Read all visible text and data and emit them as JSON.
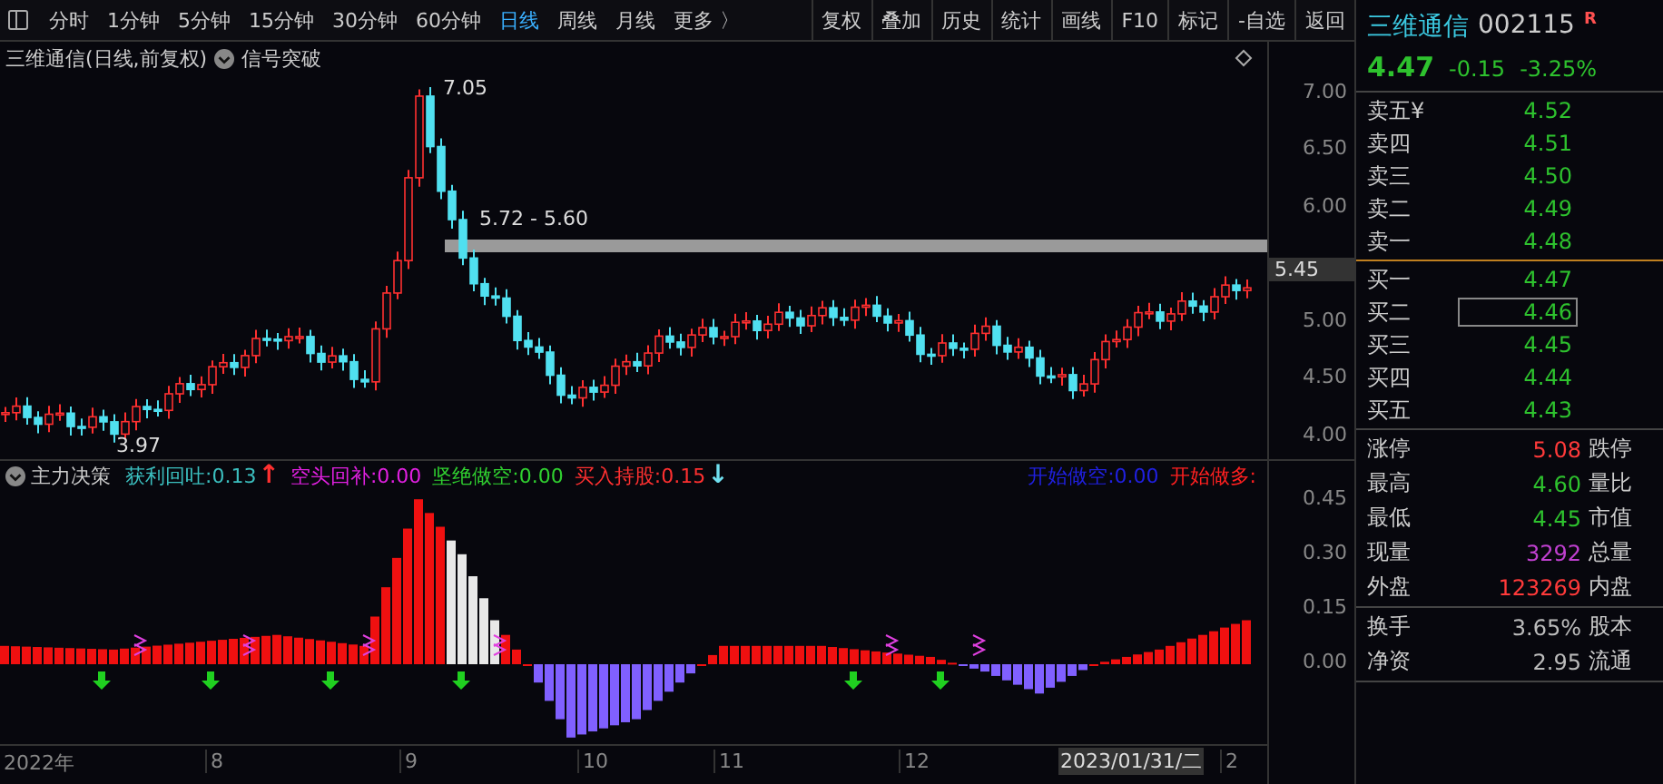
{
  "toolbar": {
    "periods": [
      {
        "label": "分时",
        "selected": false
      },
      {
        "label": "1分钟",
        "selected": false
      },
      {
        "label": "5分钟",
        "selected": false
      },
      {
        "label": "15分钟",
        "selected": false
      },
      {
        "label": "30分钟",
        "selected": false
      },
      {
        "label": "60分钟",
        "selected": false
      },
      {
        "label": "日线",
        "selected": true
      },
      {
        "label": "周线",
        "selected": false
      },
      {
        "label": "月线",
        "selected": false
      },
      {
        "label": "更多 〉",
        "selected": false
      }
    ],
    "tools": [
      "复权",
      "叠加",
      "历史",
      "统计",
      "画线",
      "F10",
      "标记",
      "-自选",
      "返回"
    ]
  },
  "chart": {
    "title": "三维通信(日线,前复权)",
    "indicator": "信号突破",
    "high_label": "7.05",
    "band_label": "5.72 - 5.60",
    "low_label": "3.97",
    "current_price": "5.45",
    "yticks": [
      "7.00",
      "6.50",
      "6.00",
      "5.00",
      "4.50",
      "4.00"
    ]
  },
  "indicator": {
    "name": "主力决策",
    "values": [
      {
        "label": "获利回吐:",
        "value": "0.13",
        "color": "#3bbfbf",
        "arrow": {
          "symbol": "↑",
          "color": "#ff3030"
        }
      },
      {
        "label": "空头回补:",
        "value": "0.00",
        "color": "#e020e0"
      },
      {
        "label": "坚绝做空:",
        "value": "0.00",
        "color": "#30d030"
      },
      {
        "label": "买入持股:",
        "value": "0.15",
        "color": "#ff3030",
        "arrow": {
          "symbol": "↓",
          "color": "#70e0f0"
        }
      },
      {
        "label": "开始做空:",
        "value": "0.00",
        "color": "#2020e0"
      },
      {
        "label": "开始做多:",
        "color": "#ff2020"
      }
    ],
    "yticks": [
      "0.45",
      "0.30",
      "0.15",
      "0.00"
    ]
  },
  "x_axis": {
    "labels": [
      "2022年",
      "8",
      "9",
      "10",
      "11",
      "12"
    ],
    "cursor_date": "2023/01/31/二",
    "last_label": "2"
  },
  "quote": {
    "name": "三维通信",
    "code": "002115",
    "badge": "R",
    "price": "4.47",
    "change": "-0.15",
    "percent": "-3.25%",
    "asks": [
      {
        "label": "卖五",
        "extra": "¥",
        "value": "4.52",
        "selected": false
      },
      {
        "label": "卖四",
        "value": "4.51",
        "selected": false
      },
      {
        "label": "卖三",
        "value": "4.50",
        "selected": false
      },
      {
        "label": "卖二",
        "value": "4.49",
        "selected": false
      },
      {
        "label": "卖一",
        "value": "4.48",
        "selected": false
      }
    ],
    "bids": [
      {
        "label": "买一",
        "value": "4.47",
        "selected": false
      },
      {
        "label": "买二",
        "value": "4.46",
        "selected": true
      },
      {
        "label": "买三",
        "value": "4.45",
        "selected": false
      },
      {
        "label": "买四",
        "value": "4.44",
        "selected": false
      },
      {
        "label": "买五",
        "value": "4.43",
        "selected": false
      }
    ],
    "stats": [
      {
        "label": "涨停",
        "value": "5.08",
        "color": "#ff3a3a",
        "label2": "跌停"
      },
      {
        "label": "最高",
        "value": "4.60",
        "color": "#2ec22e",
        "label2": "量比"
      },
      {
        "label": "最低",
        "value": "4.45",
        "color": "#2ec22e",
        "label2": "市值"
      },
      {
        "label": "现量",
        "value": "3292",
        "color": "#c040d0",
        "label2": "总量"
      },
      {
        "label": "外盘",
        "value": "123269",
        "color": "#ff3a3a",
        "label2": "内盘"
      }
    ],
    "stats2": [
      {
        "label": "换手",
        "value": "3.65%",
        "color": "#bbbbbb",
        "label2": "股本"
      },
      {
        "label": "净资",
        "value": "2.95",
        "color": "#bbbbbb",
        "label2": "流通"
      }
    ]
  }
}
